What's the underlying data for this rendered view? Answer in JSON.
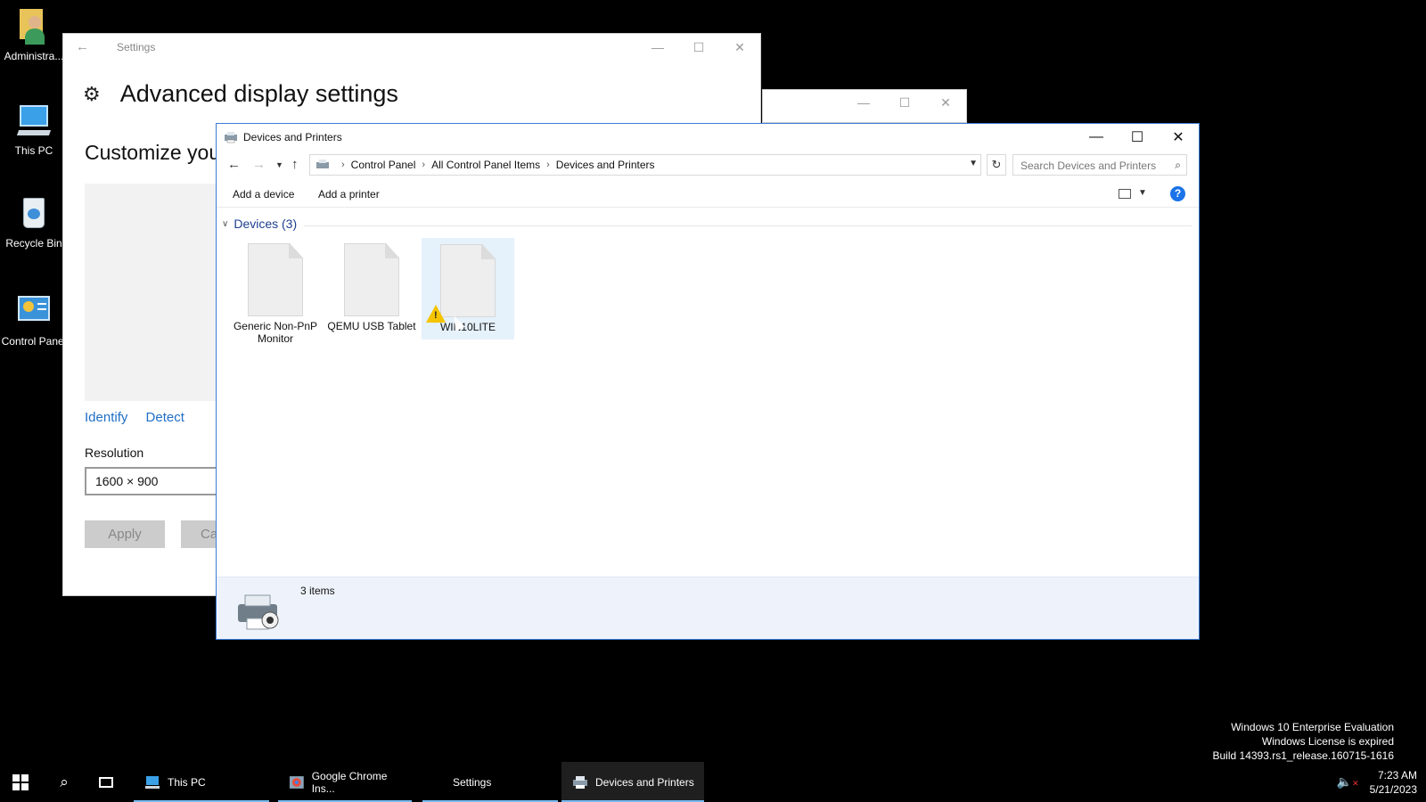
{
  "desktop": {
    "icons": [
      {
        "label": "Administra..."
      },
      {
        "label": "This PC"
      },
      {
        "label": "Recycle Bin"
      },
      {
        "label": "Control Panel"
      }
    ]
  },
  "settings": {
    "title": "Settings",
    "heading": "Advanced display settings",
    "customize": "Customize you",
    "identify": "Identify",
    "detect": "Detect",
    "resolution_label": "Resolution",
    "resolution_value": "1600 × 900",
    "apply": "Apply",
    "cancel": "Ca"
  },
  "devices": {
    "title": "Devices and Printers",
    "breadcrumb": [
      "Control Panel",
      "All Control Panel Items",
      "Devices and Printers"
    ],
    "search_placeholder": "Search Devices and Printers",
    "add_device": "Add a device",
    "add_printer": "Add a printer",
    "help": "?",
    "group_label": "Devices (3)",
    "items": [
      {
        "name": "Generic Non-PnP Monitor"
      },
      {
        "name": "QEMU USB Tablet"
      },
      {
        "name": "WIN10LITE",
        "warning": true,
        "selected": true
      }
    ],
    "status": "3 items"
  },
  "watermark": {
    "line1": "Windows 10 Enterprise Evaluation",
    "line2": "Windows License is expired",
    "line3": "Build 14393.rs1_release.160715-1616"
  },
  "taskbar": {
    "items": [
      {
        "label": "This PC"
      },
      {
        "label": "Google Chrome Ins..."
      },
      {
        "label": "Settings"
      },
      {
        "label": "Devices and Printers"
      }
    ],
    "time": "7:23 AM",
    "date": "5/21/2023"
  },
  "colors": {
    "accent": "#1f6fc5",
    "taskbar_underline": "#76b9ed",
    "warning": "#f5c400"
  }
}
